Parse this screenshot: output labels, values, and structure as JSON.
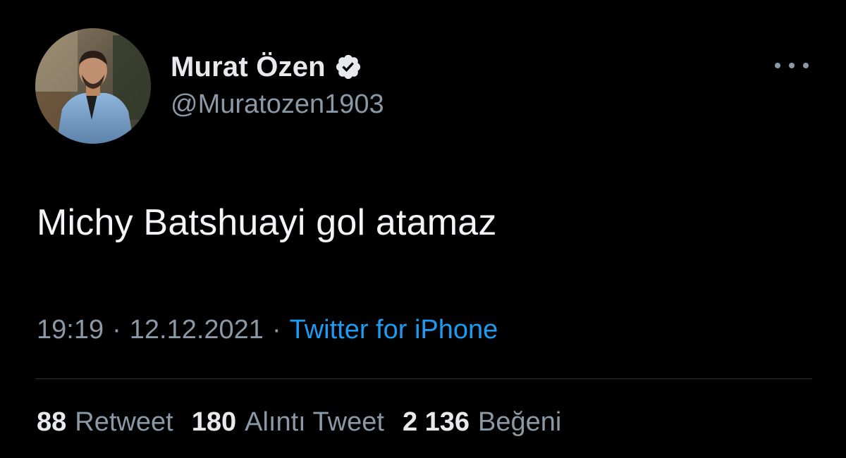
{
  "author": {
    "display_name": "Murat Özen",
    "handle": "@Muratozen1903",
    "verified": true
  },
  "tweet": {
    "text": "Michy Batshuayi gol atamaz",
    "time": "19:19",
    "date": "12.12.2021",
    "separator": "·",
    "source": "Twitter for iPhone"
  },
  "stats": [
    {
      "count": "88",
      "label": "Retweet"
    },
    {
      "count": "180",
      "label": "Alıntı Tweet"
    },
    {
      "count": "2 136",
      "label": "Beğeni"
    }
  ],
  "icons": {
    "verified": "verified-badge-icon",
    "more": "more-options-icon"
  },
  "colors": {
    "background": "#000000",
    "primary_text": "#e7e9ea",
    "secondary_text": "#8b98a5",
    "link": "#1d9bf0",
    "divider": "#2f3336"
  }
}
